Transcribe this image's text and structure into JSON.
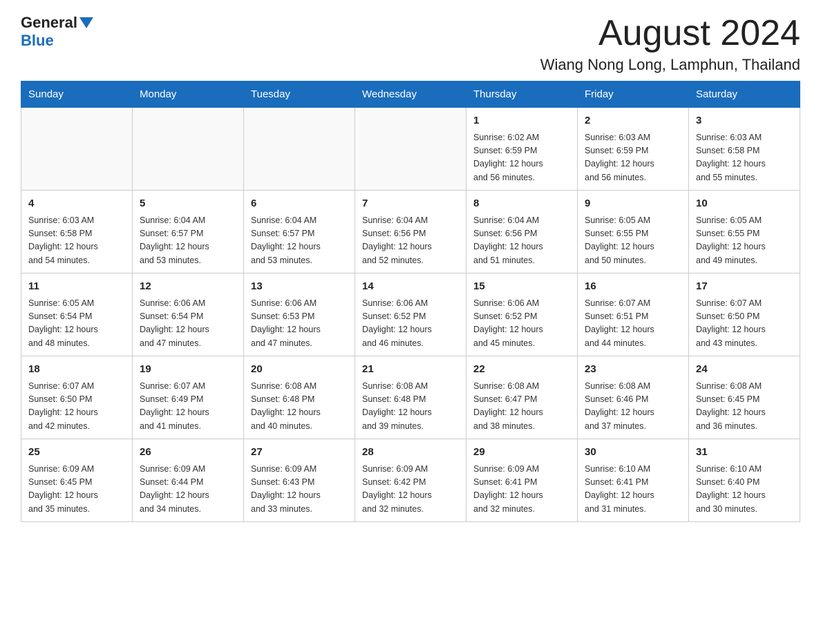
{
  "header": {
    "logo_general": "General",
    "logo_blue": "Blue",
    "month_title": "August 2024",
    "location": "Wiang Nong Long, Lamphun, Thailand"
  },
  "days_of_week": [
    "Sunday",
    "Monday",
    "Tuesday",
    "Wednesday",
    "Thursday",
    "Friday",
    "Saturday"
  ],
  "weeks": [
    [
      {
        "day": "",
        "info": ""
      },
      {
        "day": "",
        "info": ""
      },
      {
        "day": "",
        "info": ""
      },
      {
        "day": "",
        "info": ""
      },
      {
        "day": "1",
        "info": "Sunrise: 6:02 AM\nSunset: 6:59 PM\nDaylight: 12 hours\nand 56 minutes."
      },
      {
        "day": "2",
        "info": "Sunrise: 6:03 AM\nSunset: 6:59 PM\nDaylight: 12 hours\nand 56 minutes."
      },
      {
        "day": "3",
        "info": "Sunrise: 6:03 AM\nSunset: 6:58 PM\nDaylight: 12 hours\nand 55 minutes."
      }
    ],
    [
      {
        "day": "4",
        "info": "Sunrise: 6:03 AM\nSunset: 6:58 PM\nDaylight: 12 hours\nand 54 minutes."
      },
      {
        "day": "5",
        "info": "Sunrise: 6:04 AM\nSunset: 6:57 PM\nDaylight: 12 hours\nand 53 minutes."
      },
      {
        "day": "6",
        "info": "Sunrise: 6:04 AM\nSunset: 6:57 PM\nDaylight: 12 hours\nand 53 minutes."
      },
      {
        "day": "7",
        "info": "Sunrise: 6:04 AM\nSunset: 6:56 PM\nDaylight: 12 hours\nand 52 minutes."
      },
      {
        "day": "8",
        "info": "Sunrise: 6:04 AM\nSunset: 6:56 PM\nDaylight: 12 hours\nand 51 minutes."
      },
      {
        "day": "9",
        "info": "Sunrise: 6:05 AM\nSunset: 6:55 PM\nDaylight: 12 hours\nand 50 minutes."
      },
      {
        "day": "10",
        "info": "Sunrise: 6:05 AM\nSunset: 6:55 PM\nDaylight: 12 hours\nand 49 minutes."
      }
    ],
    [
      {
        "day": "11",
        "info": "Sunrise: 6:05 AM\nSunset: 6:54 PM\nDaylight: 12 hours\nand 48 minutes."
      },
      {
        "day": "12",
        "info": "Sunrise: 6:06 AM\nSunset: 6:54 PM\nDaylight: 12 hours\nand 47 minutes."
      },
      {
        "day": "13",
        "info": "Sunrise: 6:06 AM\nSunset: 6:53 PM\nDaylight: 12 hours\nand 47 minutes."
      },
      {
        "day": "14",
        "info": "Sunrise: 6:06 AM\nSunset: 6:52 PM\nDaylight: 12 hours\nand 46 minutes."
      },
      {
        "day": "15",
        "info": "Sunrise: 6:06 AM\nSunset: 6:52 PM\nDaylight: 12 hours\nand 45 minutes."
      },
      {
        "day": "16",
        "info": "Sunrise: 6:07 AM\nSunset: 6:51 PM\nDaylight: 12 hours\nand 44 minutes."
      },
      {
        "day": "17",
        "info": "Sunrise: 6:07 AM\nSunset: 6:50 PM\nDaylight: 12 hours\nand 43 minutes."
      }
    ],
    [
      {
        "day": "18",
        "info": "Sunrise: 6:07 AM\nSunset: 6:50 PM\nDaylight: 12 hours\nand 42 minutes."
      },
      {
        "day": "19",
        "info": "Sunrise: 6:07 AM\nSunset: 6:49 PM\nDaylight: 12 hours\nand 41 minutes."
      },
      {
        "day": "20",
        "info": "Sunrise: 6:08 AM\nSunset: 6:48 PM\nDaylight: 12 hours\nand 40 minutes."
      },
      {
        "day": "21",
        "info": "Sunrise: 6:08 AM\nSunset: 6:48 PM\nDaylight: 12 hours\nand 39 minutes."
      },
      {
        "day": "22",
        "info": "Sunrise: 6:08 AM\nSunset: 6:47 PM\nDaylight: 12 hours\nand 38 minutes."
      },
      {
        "day": "23",
        "info": "Sunrise: 6:08 AM\nSunset: 6:46 PM\nDaylight: 12 hours\nand 37 minutes."
      },
      {
        "day": "24",
        "info": "Sunrise: 6:08 AM\nSunset: 6:45 PM\nDaylight: 12 hours\nand 36 minutes."
      }
    ],
    [
      {
        "day": "25",
        "info": "Sunrise: 6:09 AM\nSunset: 6:45 PM\nDaylight: 12 hours\nand 35 minutes."
      },
      {
        "day": "26",
        "info": "Sunrise: 6:09 AM\nSunset: 6:44 PM\nDaylight: 12 hours\nand 34 minutes."
      },
      {
        "day": "27",
        "info": "Sunrise: 6:09 AM\nSunset: 6:43 PM\nDaylight: 12 hours\nand 33 minutes."
      },
      {
        "day": "28",
        "info": "Sunrise: 6:09 AM\nSunset: 6:42 PM\nDaylight: 12 hours\nand 32 minutes."
      },
      {
        "day": "29",
        "info": "Sunrise: 6:09 AM\nSunset: 6:41 PM\nDaylight: 12 hours\nand 32 minutes."
      },
      {
        "day": "30",
        "info": "Sunrise: 6:10 AM\nSunset: 6:41 PM\nDaylight: 12 hours\nand 31 minutes."
      },
      {
        "day": "31",
        "info": "Sunrise: 6:10 AM\nSunset: 6:40 PM\nDaylight: 12 hours\nand 30 minutes."
      }
    ]
  ]
}
